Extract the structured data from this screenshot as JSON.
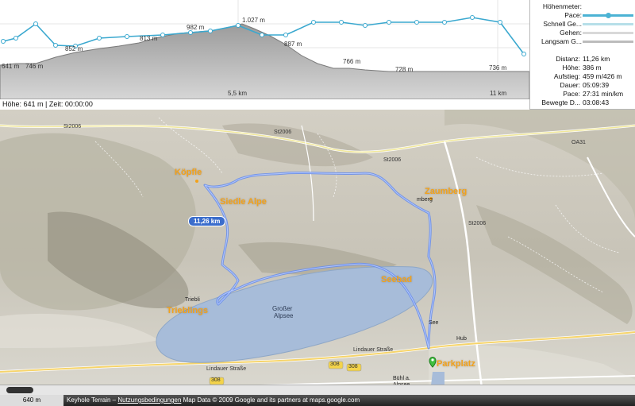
{
  "profile": {
    "elevation_labels": [
      "641 m",
      "746 m",
      "852 m",
      "813 m",
      "982 m",
      "1.027 m",
      "887 m",
      "766 m",
      "728 m",
      "736 m"
    ],
    "distance_labels": [
      "5,5 km",
      "11 km"
    ],
    "status": "Höhe: 641 m | Zeit: 00:00:00"
  },
  "legend": [
    {
      "label": "Höhenmeter:",
      "color": ""
    },
    {
      "label": "Pace:",
      "color": "#4cb3d4"
    },
    {
      "label": "Schnell Ge...",
      "color": "#b7dfe9"
    },
    {
      "label": "Gehen:",
      "color": "#d9d9d9"
    },
    {
      "label": "Langsam G...",
      "color": "#bcbcbc"
    }
  ],
  "stats": [
    {
      "label": "Distanz:",
      "value": "11,26 km"
    },
    {
      "label": "Höhe:",
      "value": "386 m"
    },
    {
      "label": "Aufstieg:",
      "value": "459 m/426 m"
    },
    {
      "label": "Dauer:",
      "value": "05:09:39"
    },
    {
      "label": "Pace:",
      "value": "27:31 min/km"
    },
    {
      "label": "Bewegte D...",
      "value": "03:08:43"
    }
  ],
  "map": {
    "places": {
      "koepfle": "Köpfle",
      "siedle_alpe": "Siedle Alpe",
      "zaumberg": "Zaumberg",
      "seebad": "Seebad",
      "trieblings": "Trieblings",
      "parkplatz": "Parkplatz"
    },
    "route_badge": "11,26 km",
    "lake_name_1": "Großer",
    "lake_name_2": "Alpsee",
    "small_labels": {
      "see": "See",
      "hub": "Hub",
      "buehl": "Bühl a.",
      "alpsee": "Alpsee",
      "triebl": "Triebli",
      "mberg": "mberg"
    },
    "roads": {
      "st2006_a": "St2006",
      "st2006_b": "St2006",
      "st2006_c": "St2006",
      "st2006_d": "St2006",
      "oa31": "OA31",
      "lindauer_1": "Lindauer Straße",
      "lindauer_2": "Lindauer Straße",
      "b308_a": "308",
      "b308_b": "308",
      "b308_c": "308",
      "b308_d": "308"
    }
  },
  "footer": {
    "scale": "640 m",
    "credits_prefix": "Keyhole Terrain – ",
    "credits_link": "Nutzungsbedingungen",
    "credits_suffix": " Map Data © 2009 Google and its partners at maps.google.com"
  }
}
